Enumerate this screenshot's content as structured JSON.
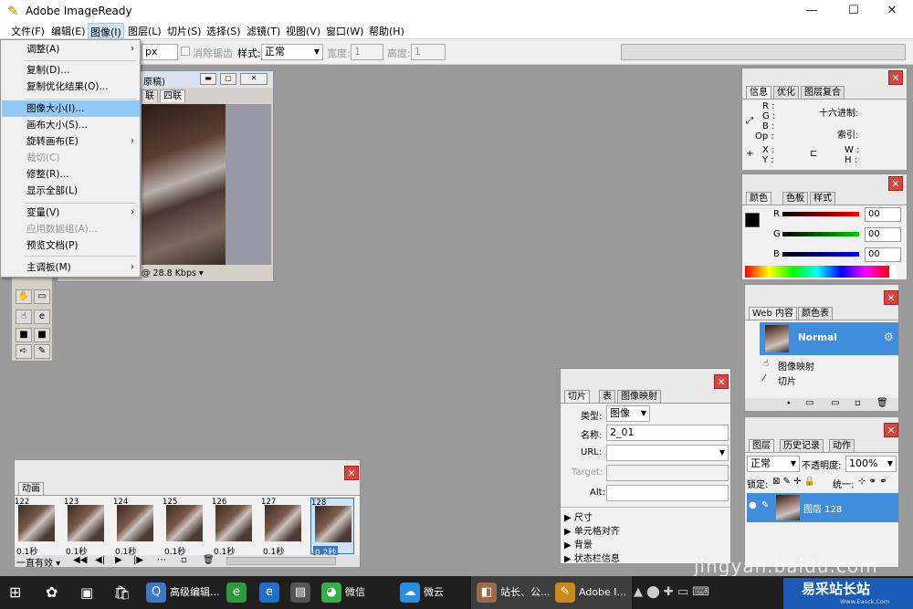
{
  "titlebar": {
    "title": "Adobe ImageReady",
    "min": "—",
    "max": "☐",
    "close": "✕"
  },
  "menu": [
    "文件(F)",
    "编辑(E)",
    "图像(I)",
    "图层(L)",
    "切片(S)",
    "选择(S)",
    "滤镜(T)",
    "视图(V)",
    "窗口(W)",
    "帮助(H)"
  ],
  "optbar": {
    "px": "px",
    "antialias": "消除锯齿",
    "style_label": "样式:",
    "style_value": "正常",
    "width_label": "宽度:",
    "width_value": "1",
    "height_label": "高度:",
    "height_value": "1"
  },
  "dropdown": [
    "调整(A)",
    "复制(D)...",
    "复制优化结果(O)...",
    "图像大小(I)...",
    "画布大小(S)...",
    "旋转画布(E)",
    "裁切(C)",
    "修整(R)...",
    "显示全部(L)",
    "变量(V)",
    "应用数据组(A)...",
    "预览文档(P)",
    "主调板(M)"
  ],
  "docwin": {
    "title": "原稿)",
    "tabs": [
      "联",
      "四联"
    ],
    "status": "@ 28.8 Kbps"
  },
  "info": {
    "tabs": [
      "信息",
      "优化",
      "图层复合"
    ],
    "r": "R :",
    "g": "G :",
    "b": "B :",
    "op": "Op :",
    "hex": "十六进制:",
    "index": "索引:",
    "x": "X :",
    "y": "Y :",
    "w": "W :",
    "h": "H :"
  },
  "color": {
    "tabs": [
      "颜色",
      "色板",
      "样式"
    ],
    "r": "R",
    "g": "G",
    "b": "B",
    "rv": "00",
    "gv": "00",
    "bv": "00"
  },
  "web": {
    "tabs": [
      "Web 内容",
      "颜色表"
    ],
    "normal": "Normal",
    "imagemap": "图像映射",
    "slice": "切片"
  },
  "layers": {
    "tabs": [
      "图层",
      "历史记录",
      "动作"
    ],
    "mode": "正常",
    "opacity_label": "不透明度:",
    "opacity": "100%",
    "lock": "锁定:",
    "unify": "统一:",
    "layer": "图层 128"
  },
  "slice": {
    "tabs": [
      "切片",
      "表",
      "图像映射"
    ],
    "type_label": "类型:",
    "type": "图像",
    "name_label": "名称:",
    "name": "2_01",
    "url_label": "URL:",
    "target_label": "Target:",
    "alt_label": "Alt:",
    "sections": [
      "尺寸",
      "单元格对齐",
      "背景",
      "状态栏信息"
    ]
  },
  "anim": {
    "tab": "动画",
    "frames": [
      {
        "n": "122",
        "d": "0.1秒"
      },
      {
        "n": "123",
        "d": "0.1秒"
      },
      {
        "n": "124",
        "d": "0.1秒"
      },
      {
        "n": "125",
        "d": "0.1秒"
      },
      {
        "n": "126",
        "d": "0.1秒"
      },
      {
        "n": "127",
        "d": "0.1秒"
      },
      {
        "n": "128",
        "d": "0.2秒"
      }
    ],
    "loop": "一直有效"
  },
  "taskbar": {
    "items": [
      "高级编辑...",
      "微信",
      "微云",
      "站长、公...",
      "Adobe I..."
    ],
    "brand": "易采站长站",
    "brand_sub": "Www.Easck.Com"
  },
  "watermark": "jingyan.baidu.com"
}
